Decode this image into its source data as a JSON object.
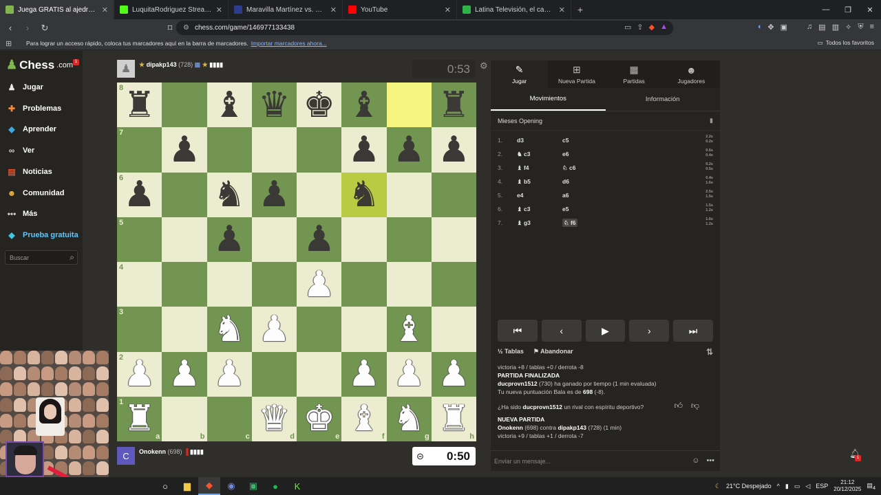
{
  "browser": {
    "tabs": [
      {
        "title": "Juega GRATIS al ajedrez onlin",
        "color": "#81b64c",
        "active": true
      },
      {
        "title": "LuquitaRodriguez Stream - Watc",
        "color": "#53fc18",
        "active": false
      },
      {
        "title": "Maravilla Martínez vs. Pepi Staropoli",
        "color": "#2b3d8c",
        "active": false
      },
      {
        "title": "YouTube",
        "color": "#ff0000",
        "active": false
      },
      {
        "title": "Latina Televisión, el canal 2 de siemp",
        "color": "#2fb34a",
        "active": false
      }
    ],
    "url": "chess.com/game/146977133438",
    "bookmarks_text": "Para lograr un acceso rápido, coloca tus marcadores aquí en la barra de marcadores.",
    "bookmarks_link": "Importar marcadores ahora...",
    "all_favorites": "Todos los favoritos"
  },
  "sidebar": {
    "logo": "Chess",
    "logo_suffix": ".com",
    "badge": "1",
    "items": [
      {
        "label": "Jugar",
        "icon": "pawn-icon",
        "color": "#e8e8e8"
      },
      {
        "label": "Problemas",
        "icon": "puzzle-icon",
        "color": "#f08a3c"
      },
      {
        "label": "Aprender",
        "icon": "lesson-icon",
        "color": "#3fa8e0"
      },
      {
        "label": "Ver",
        "icon": "binoculars-icon",
        "color": "#d0d0d0"
      },
      {
        "label": "Noticias",
        "icon": "news-icon",
        "color": "#e0502e"
      },
      {
        "label": "Comunidad",
        "icon": "community-icon",
        "color": "#e8b33c"
      },
      {
        "label": "Más",
        "icon": "more-icon",
        "color": "#cccccc"
      },
      {
        "label": "Prueba gratuita",
        "icon": "diamond-icon",
        "color": "#3fc8e0",
        "highlight": true
      }
    ],
    "search_placeholder": "Buscar"
  },
  "game": {
    "top_player": {
      "name": "dipakp143",
      "rating": "(728)",
      "clock": "0:53"
    },
    "bottom_player": {
      "name": "Onokenn",
      "rating": "(698)",
      "clock": "0:50",
      "avatar_letter": "C"
    },
    "files": [
      "a",
      "b",
      "c",
      "d",
      "e",
      "f",
      "g",
      "h"
    ],
    "ranks": [
      "8",
      "7",
      "6",
      "5",
      "4",
      "3",
      "2",
      "1"
    ],
    "board": [
      [
        "br",
        "",
        "bb",
        "bq",
        "bk",
        "bb",
        "",
        "br"
      ],
      [
        "",
        "bp",
        "",
        "",
        "",
        "bp",
        "bp",
        "bp"
      ],
      [
        "bp",
        "",
        "bn",
        "bp",
        "",
        "bn",
        "",
        ""
      ],
      [
        "",
        "",
        "bp",
        "",
        "bp",
        "",
        "",
        ""
      ],
      [
        "",
        "",
        "",
        "",
        "wp",
        "",
        "",
        ""
      ],
      [
        "",
        "",
        "wn",
        "wp",
        "",
        "",
        "wb",
        ""
      ],
      [
        "wp",
        "wp",
        "wp",
        "",
        "",
        "wp",
        "wp",
        "wp"
      ],
      [
        "wr",
        "",
        "",
        "wq",
        "wk",
        "wb",
        "wn",
        "wr"
      ]
    ],
    "highlight": [
      "g8",
      "f6"
    ]
  },
  "panel": {
    "tabs": [
      {
        "label": "Jugar",
        "icon": "play-icon",
        "active": true
      },
      {
        "label": "Nueva Partida",
        "icon": "plus-icon",
        "active": false
      },
      {
        "label": "Partidas",
        "icon": "board-icon",
        "active": false
      },
      {
        "label": "Jugadores",
        "icon": "players-icon",
        "active": false
      }
    ],
    "subtabs": [
      {
        "label": "Movimientos",
        "active": true
      },
      {
        "label": "Información",
        "active": false
      }
    ],
    "opening": "Mieses Opening",
    "moves": [
      {
        "n": "1.",
        "w": "d3",
        "b": "c5",
        "wt": "2.2s",
        "bt": "0.2s"
      },
      {
        "n": "2.",
        "w": "♞ c3",
        "b": "e6",
        "wt": "0.6s",
        "bt": "0.4s"
      },
      {
        "n": "3.",
        "w": "♝ f4",
        "b": "♘ c6",
        "wt": "0.2s",
        "bt": "0.5s"
      },
      {
        "n": "4.",
        "w": "♝ b5",
        "b": "d6",
        "wt": "0.4s",
        "bt": "1.6s"
      },
      {
        "n": "5.",
        "w": "e4",
        "b": "a6",
        "wt": "2.5s",
        "bt": "1.5s"
      },
      {
        "n": "6.",
        "w": "♝ c3",
        "b": "e5",
        "wt": "1.5s",
        "bt": "1.2s"
      },
      {
        "n": "7.",
        "w": "♝ g3",
        "b": "♘ f6",
        "wt": "1.6s",
        "bt": "1.2s"
      }
    ],
    "draw": "Tablas",
    "draw_prefix": "½",
    "resign": "Abandonar",
    "chat": {
      "line1": "victoria +8 / tablas +0 / derrota -8",
      "finished_title": "PARTIDA FINALIZADA",
      "winner": "ducprovn1512",
      "winner_rest": "(730) ha ganado por tiempo (1 min evaluada)",
      "rating_prefix": "Tu nueva puntuación Bala es de",
      "rating_value": "698",
      "rating_suffix": "(-8).",
      "sport_prefix": "¿Ha sido",
      "sport_name": "ducprovn1512",
      "sport_suffix": "un rival con espíritu deportivo?",
      "new_title": "NUEVA PARTIDA",
      "p1": "Onokenn",
      "vs_mid": "(698) contra",
      "p2": "dipakp143",
      "vs_end": "(728) (1 min)",
      "line_last": "victoria +9 / tablas +1 / derrota -7"
    },
    "message_placeholder": "Enviar un mensaje..."
  },
  "notifications": "1",
  "taskbar": {
    "weather": "21°C Despejado",
    "lang": "ESP",
    "time": "21:12",
    "date": "20/12/2025",
    "notif": "4"
  }
}
